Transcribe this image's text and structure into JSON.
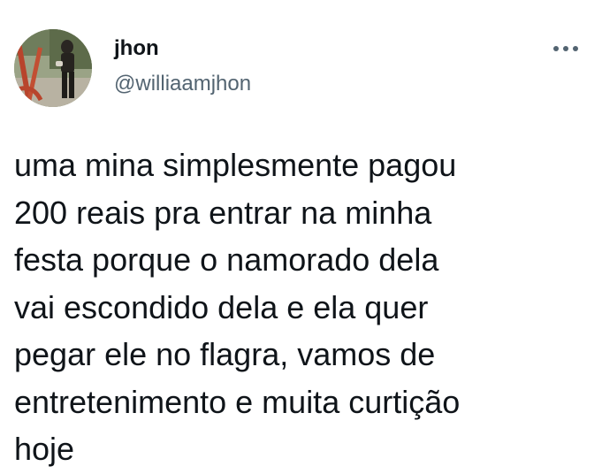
{
  "author": {
    "display_name": "jhon",
    "handle": "@williaamjhon"
  },
  "icons": {
    "more": "more-options-icon",
    "avatar": "profile-photo"
  },
  "tweet": {
    "text": "uma mina simplesmente pagou\n200 reais pra entrar na minha\nfesta porque o namorado dela\nvai escondido dela e ela quer\npegar ele no flagra, vamos de\nentretenimento e muita curtição\nhoje"
  },
  "colors": {
    "text_primary": "#0f1419",
    "text_secondary": "#536471",
    "background": "#ffffff"
  }
}
